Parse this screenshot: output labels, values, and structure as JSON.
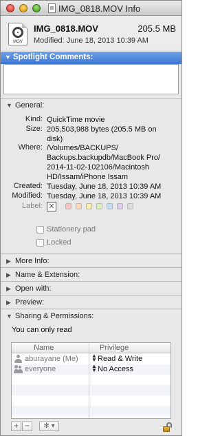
{
  "window": {
    "title": "IMG_0818.MOV Info"
  },
  "header": {
    "file_name": "IMG_0818.MOV",
    "file_size": "205.5 MB",
    "modified": "Modified: June 18, 2013 10:39 AM",
    "icon_ext": "MOV"
  },
  "spotlight": {
    "label": "Spotlight Comments:"
  },
  "general": {
    "label": "General:",
    "kind_key": "Kind:",
    "kind_val": "QuickTime movie",
    "size_key": "Size:",
    "size_val_1": "205,503,988 bytes (205.5 MB on",
    "size_val_2": "disk)",
    "where_key": "Where:",
    "where_val_1": "/Volumes/BACKUPS/",
    "where_val_2": "Backups.backupdb/MacBook Pro/",
    "where_val_3": "2014-11-02-102106/Macintosh",
    "where_val_4": "HD/Issam/iPhone Issam",
    "created_key": "Created:",
    "created_val": "Tuesday, June 18, 2013 10:39 AM",
    "modified_key": "Modified:",
    "modified_val": "Tuesday, June 18, 2013 10:39 AM",
    "label_key": "Label:",
    "label_none": "✕",
    "label_colors": [
      "#f6c3c3",
      "#fbd8b3",
      "#fbf0ae",
      "#d8efb5",
      "#c3dcf7",
      "#e0ccef",
      "#dcdcdc"
    ],
    "stationery": "Stationery pad",
    "locked": "Locked"
  },
  "sections": {
    "more_info": "More Info:",
    "name_ext": "Name & Extension:",
    "open_with": "Open with:",
    "preview": "Preview:",
    "sharing": "Sharing & Permissions:"
  },
  "permissions": {
    "read_status": "You can only read",
    "col_name": "Name",
    "col_priv": "Privilege",
    "rows": [
      {
        "name": "aburayane (Me)",
        "privilege": "Read & Write"
      },
      {
        "name": "everyone",
        "privilege": "No Access"
      }
    ]
  },
  "toolbar": {
    "add": "+",
    "remove": "−",
    "action": "✻ ▾"
  },
  "icons": {
    "expanded": "▼",
    "collapsed": "▶",
    "updown": "▲▼"
  },
  "colors": {
    "spotlight_bar": "#4a86db"
  }
}
